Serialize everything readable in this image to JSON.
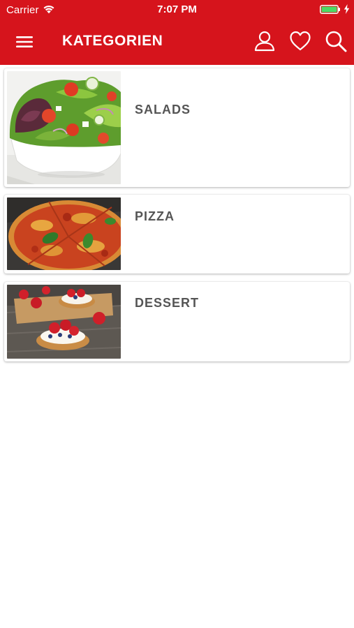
{
  "status_bar": {
    "carrier": "Carrier",
    "time": "7:07 PM",
    "battery_color": "#4cd964"
  },
  "nav": {
    "title": "KATEGORIEN",
    "background": "#d6141c",
    "icons": [
      "menu-icon",
      "user-icon",
      "heart-icon",
      "search-icon"
    ]
  },
  "categories": [
    {
      "label": "SALADS",
      "image": "salad-bowl-image"
    },
    {
      "label": "PIZZA",
      "image": "pizza-image"
    },
    {
      "label": "DESSERT",
      "image": "strawberry-tart-image"
    }
  ]
}
